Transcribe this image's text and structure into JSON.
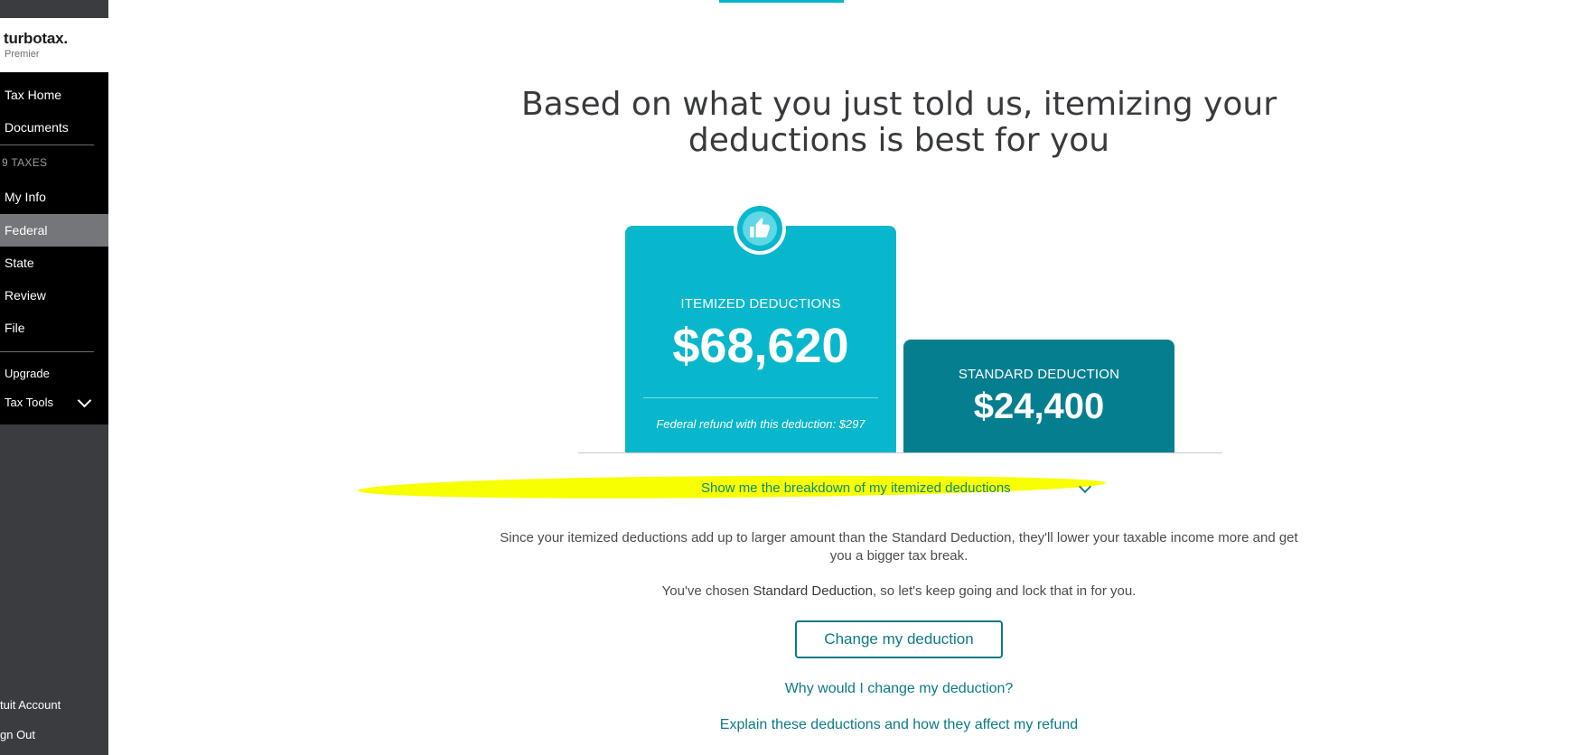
{
  "app": {
    "brand": "turbotax",
    "edition": "Premier"
  },
  "sidebar": {
    "nav": [
      {
        "label": "Tax Home"
      },
      {
        "label": "Documents"
      },
      {
        "label": "My Info"
      },
      {
        "label": "Federal",
        "active": true
      },
      {
        "label": "State"
      },
      {
        "label": "Review"
      },
      {
        "label": "File"
      }
    ],
    "section_label": "9 TAXES",
    "upgrade": "Upgrade",
    "tax_tools": "Tax Tools",
    "intuit_account": "tuit Account",
    "sign_out": "gn Out"
  },
  "main": {
    "heading_line1": "Based on what you just told us, itemizing your",
    "heading_line2": "deductions is best for you",
    "itemized": {
      "label": "ITEMIZED DEDUCTIONS",
      "amount": "$68,620",
      "note": "Federal refund with this deduction: $297"
    },
    "standard": {
      "label": "STANDARD DEDUCTION",
      "amount": "$24,400"
    },
    "breakdown_link": "Show me the breakdown of my itemized deductions",
    "explain_text": "Since your itemized deductions add up to larger amount than the Standard Deduction, they'll lower your taxable income more and get you a bigger tax break.",
    "chosen_prefix": "You've chosen ",
    "chosen_value": "Standard Deduction",
    "chosen_suffix": ", so let's keep going and lock that in for you.",
    "change_button": "Change my deduction",
    "why_link": "Why would I change my deduction?",
    "explain_link": "Explain these deductions and how they affect my refund"
  },
  "colors": {
    "itemized_card": "#08b7cb",
    "standard_card": "#057f8f",
    "link": "#0d7a85",
    "highlight": "#f7ff00",
    "sidebar_bg": "#000000"
  },
  "icons": [
    "thumbs-up-icon",
    "chevron-down-icon"
  ]
}
